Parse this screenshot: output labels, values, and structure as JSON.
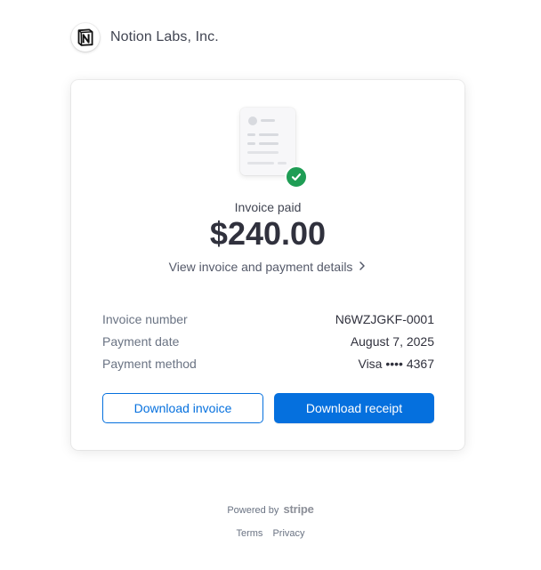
{
  "merchant": {
    "name": "Notion Labs, Inc.",
    "logo_icon": "notion-logo-icon"
  },
  "receipt": {
    "illustration_icon": "invoice-document-icon",
    "status_icon": "check-circle-icon",
    "status_color": "#1f9d55",
    "status_label": "Invoice paid",
    "amount": "$240.00",
    "details_link": "View invoice and payment details",
    "details_link_icon": "chevron-right-icon",
    "summary": [
      {
        "label": "Invoice number",
        "value": "N6WZJGKF-0001"
      },
      {
        "label": "Payment date",
        "value": "August 7, 2025"
      },
      {
        "label": "Payment method",
        "value": "Visa •••• 4367"
      }
    ],
    "buttons": {
      "download_invoice": "Download invoice",
      "download_receipt": "Download receipt"
    },
    "accent_color": "#0570de"
  },
  "footer": {
    "powered_by": "Powered by",
    "brand": "stripe",
    "links": [
      "Terms",
      "Privacy"
    ]
  }
}
